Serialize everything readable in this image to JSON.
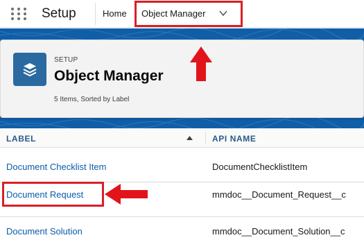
{
  "nav": {
    "app_title": "Setup",
    "items": [
      {
        "label": "Home"
      },
      {
        "label": "Object Manager"
      }
    ]
  },
  "header": {
    "eyebrow": "SETUP",
    "title": "Object Manager",
    "meta": "5 Items, Sorted by Label"
  },
  "table": {
    "columns": [
      "LABEL",
      "API NAME"
    ],
    "sort_column": "LABEL",
    "sort_direction": "ascending",
    "rows": [
      {
        "label": "Document Checklist Item",
        "api_name": "DocumentChecklistItem"
      },
      {
        "label": "Document Request",
        "api_name": "mmdoc__Document_Request__c"
      },
      {
        "label": "Document Solution",
        "api_name": "mmdoc__Document_Solution__c"
      }
    ]
  },
  "annotations": {
    "highlight_color": "#d81f26",
    "highlighted": [
      "Object Manager",
      "Document Request"
    ]
  },
  "colors": {
    "banner": "#0f5ea8",
    "link": "#0b5cab",
    "header_text": "#2a5a87",
    "icon_bg": "#2b6aa0"
  },
  "icons": [
    "app-launcher-icon",
    "chevron-down-icon",
    "layers-icon",
    "sort-ascending-icon",
    "arrow-up-annotation",
    "arrow-left-annotation"
  ]
}
